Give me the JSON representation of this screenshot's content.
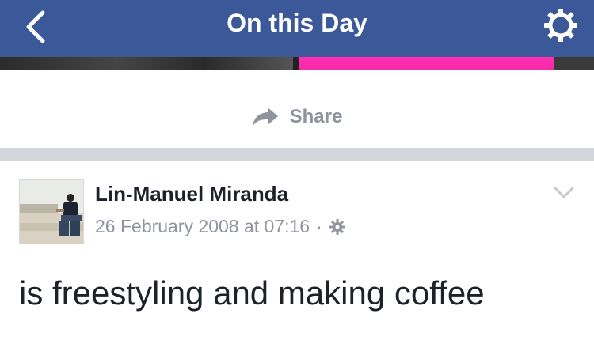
{
  "header": {
    "title": "On this Day",
    "back_icon": "chevron-left-icon",
    "settings_icon": "gear-icon",
    "background": "#3b5998"
  },
  "share": {
    "label": "Share",
    "icon": "share-arrow-icon"
  },
  "post": {
    "author": "Lin-Manuel Miranda",
    "date": "26 February 2008 at 07:16",
    "separator": "·",
    "privacy_icon": "gear-icon",
    "menu_icon": "chevron-down-icon",
    "text": "is freestyling and making coffee"
  },
  "colors": {
    "header_blue": "#3b5998",
    "secondary_text": "#8d949e",
    "primary_text": "#1d2129",
    "divider": "#d3d6db"
  }
}
